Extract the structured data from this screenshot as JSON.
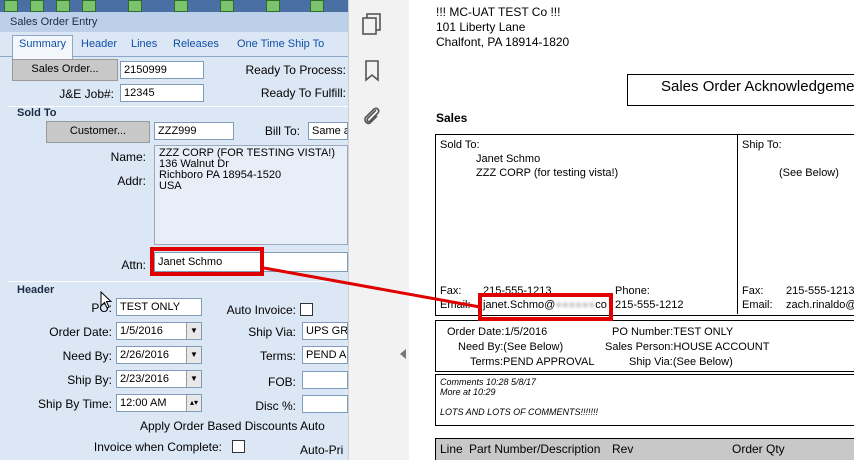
{
  "window": {
    "title": "Sales Order Entry"
  },
  "tabs": [
    "Summary",
    "Header",
    "Lines",
    "Releases",
    "One Time Ship To"
  ],
  "summary": {
    "sales_order_btn": "Sales Order...",
    "sales_order_value": "2150999",
    "ready_to_process_label": "Ready To Process:",
    "jobnum_label": "J&E Job#:",
    "jobnum_value": "12345",
    "ready_to_fulfill_label": "Ready To Fulfill:",
    "sold_to_section": "Sold To",
    "customer_btn": "Customer...",
    "customer_value": "ZZZ999",
    "bill_to_label": "Bill To:",
    "bill_to_value": "Same a",
    "name_label": "Name:",
    "addr_label": "Addr:",
    "address_lines": [
      "ZZZ CORP (FOR TESTING VISTA!)",
      "136 Walnut Dr",
      "Richboro PA 18954-1520",
      "USA"
    ],
    "attn_label": "Attn:",
    "attn_value": "Janet Schmo"
  },
  "header_section": {
    "title": "Header",
    "po_label": "PO:",
    "po_value": "TEST ONLY",
    "auto_invoice_label": "Auto Invoice:",
    "order_date_label": "Order Date:",
    "order_date_value": "1/5/2016",
    "ship_via_label": "Ship Via:",
    "ship_via_value": "UPS GR",
    "need_by_label": "Need By:",
    "need_by_value": "2/26/2016",
    "terms_label": "Terms:",
    "terms_value": "PEND AP",
    "ship_by_label": "Ship By:",
    "ship_by_value": "2/23/2016",
    "fob_label": "FOB:",
    "ship_by_time_label": "Ship By Time:",
    "ship_by_time_value": "12:00 AM",
    "disc_label": "Disc %:",
    "apply_discounts_label": "Apply Order Based Discounts Auto",
    "invoice_when_complete_label": "Invoice when Complete:",
    "auto_pri_label": "Auto-Pri"
  },
  "document": {
    "company_name": "!!! MC-UAT TEST Co !!!",
    "company_address1": "101 Liberty Lane",
    "company_address2": "Chalfont, PA  18914-1820",
    "title": "Sales Order Acknowledgeme",
    "section": "Sales",
    "sold_to_label": "Sold To:",
    "sold_to_name": "Janet Schmo",
    "sold_to_company": "ZZZ CORP (for testing vista!)",
    "ship_to_label": "Ship To:",
    "ship_to_value": "(See Below)",
    "fax_label": "Fax:",
    "fax_value": "215-555-1213",
    "phone_label": "Phone:",
    "phone_value": "215-555-1212",
    "email_label": "Email:",
    "email_value": "janet.Schmo@",
    "email_tail": "co",
    "ship_fax_label": "Fax:",
    "ship_fax_value": "215-555-1213",
    "ship_email_label": "Email:",
    "ship_email_value": "zach.rinaldo@",
    "order_date_line": "Order Date:1/5/2016",
    "need_by_line": "Need By:(See Below)",
    "terms_line": "Terms:PEND APPROVAL",
    "po_number_line": "PO Number:TEST ONLY",
    "sales_person_line": "Sales Person:HOUSE ACCOUNT",
    "ship_via_line": "Ship Via:(See Below)",
    "comments": [
      "Comments 10:28 5/8/17",
      "More at 10:29",
      "",
      "LOTS AND LOTS OF COMMENTS!!!!!!!"
    ],
    "table_headers": [
      "Line",
      "Part Number/Description",
      "Rev",
      "Order Qty"
    ]
  },
  "colors": {
    "highlight": "#e00000",
    "form_bg": "#dce7f5"
  }
}
